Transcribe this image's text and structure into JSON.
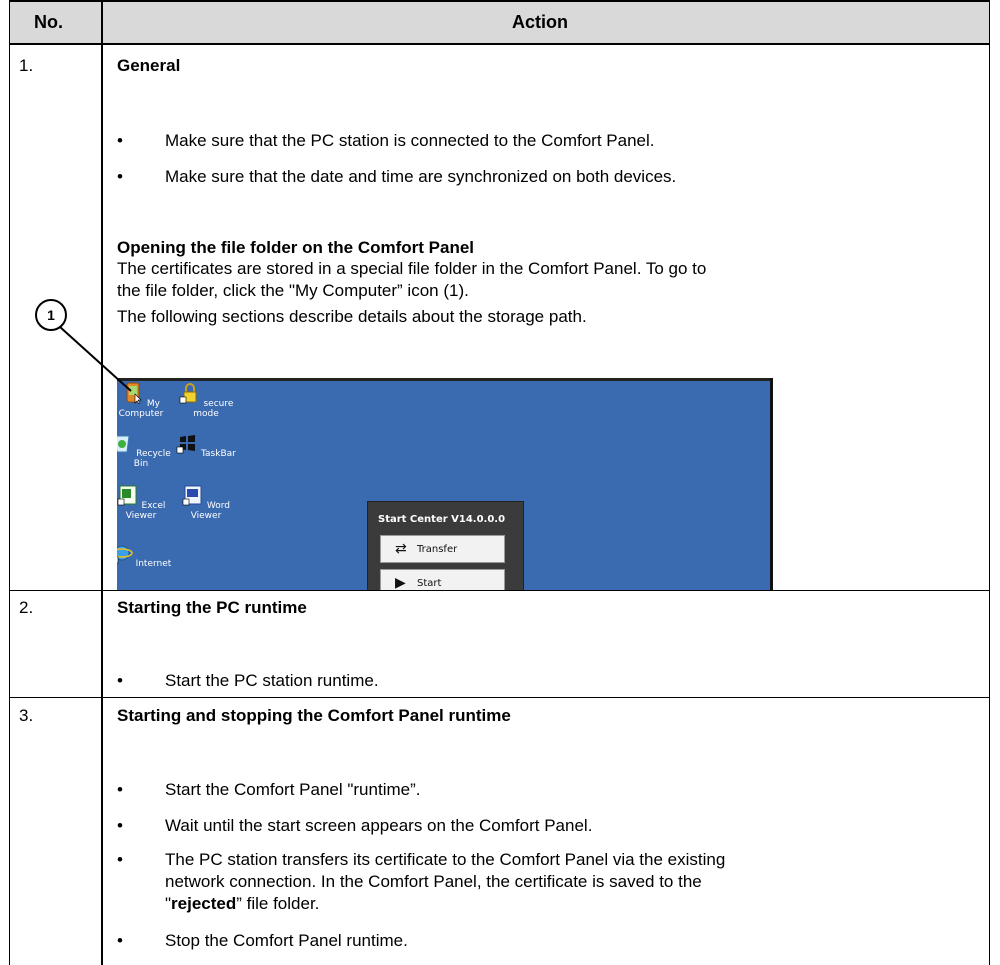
{
  "header": {
    "col_no": "No.",
    "col_action": "Action"
  },
  "rows": [
    {
      "no": "1.",
      "title": "General",
      "bullets": [
        "Make sure that the PC station is connected to the Comfort Panel.",
        "Make sure that the date and time are synchronized on both devices."
      ],
      "subheading": "Opening the file folder on the Comfort Panel",
      "para_line1": "The certificates are stored in a special file folder in the Comfort Panel. To go to",
      "para_line2": "the file folder, click the \"My Computer” icon (1).",
      "para2": "The following sections describe details about the storage path.",
      "callout": "1",
      "screenshot": {
        "icons": {
          "my_computer": "My Computer",
          "secure_mode": "secure mode",
          "recycle_bin": "Recycle Bin",
          "taskbar": "TaskBar",
          "excel_viewer": "Excel Viewer",
          "word_viewer": "Word Viewer",
          "internet": "Internet"
        },
        "start_center_title": "Start Center V14.0.0.0",
        "transfer_button": "Transfer",
        "start_button": "Start",
        "desktop_color": "#3a6ab0"
      }
    },
    {
      "no": "2.",
      "title": "Starting the PC runtime",
      "bullets": [
        "Start the PC station runtime."
      ]
    },
    {
      "no": "3.",
      "title": "Starting and stopping the Comfort Panel runtime",
      "bullets": [
        "Start the Comfort Panel \"runtime”.",
        "Wait until the start screen appears on the Comfort Panel."
      ],
      "bullet3_line1": "The PC station transfers its certificate to the Comfort Panel via the existing",
      "bullet3_line2": "network connection. In the Comfort Panel, the certificate is saved to the",
      "bullet3_line3_pre": "\"",
      "bullet3_line3_bold": "rejected",
      "bullet3_line3_post": "” file folder.",
      "bullet4": "Stop the Comfort Panel runtime."
    }
  ],
  "bullet_char": "•",
  "colors": {
    "header_bg": "#d9d9d9",
    "border": "#000000"
  }
}
